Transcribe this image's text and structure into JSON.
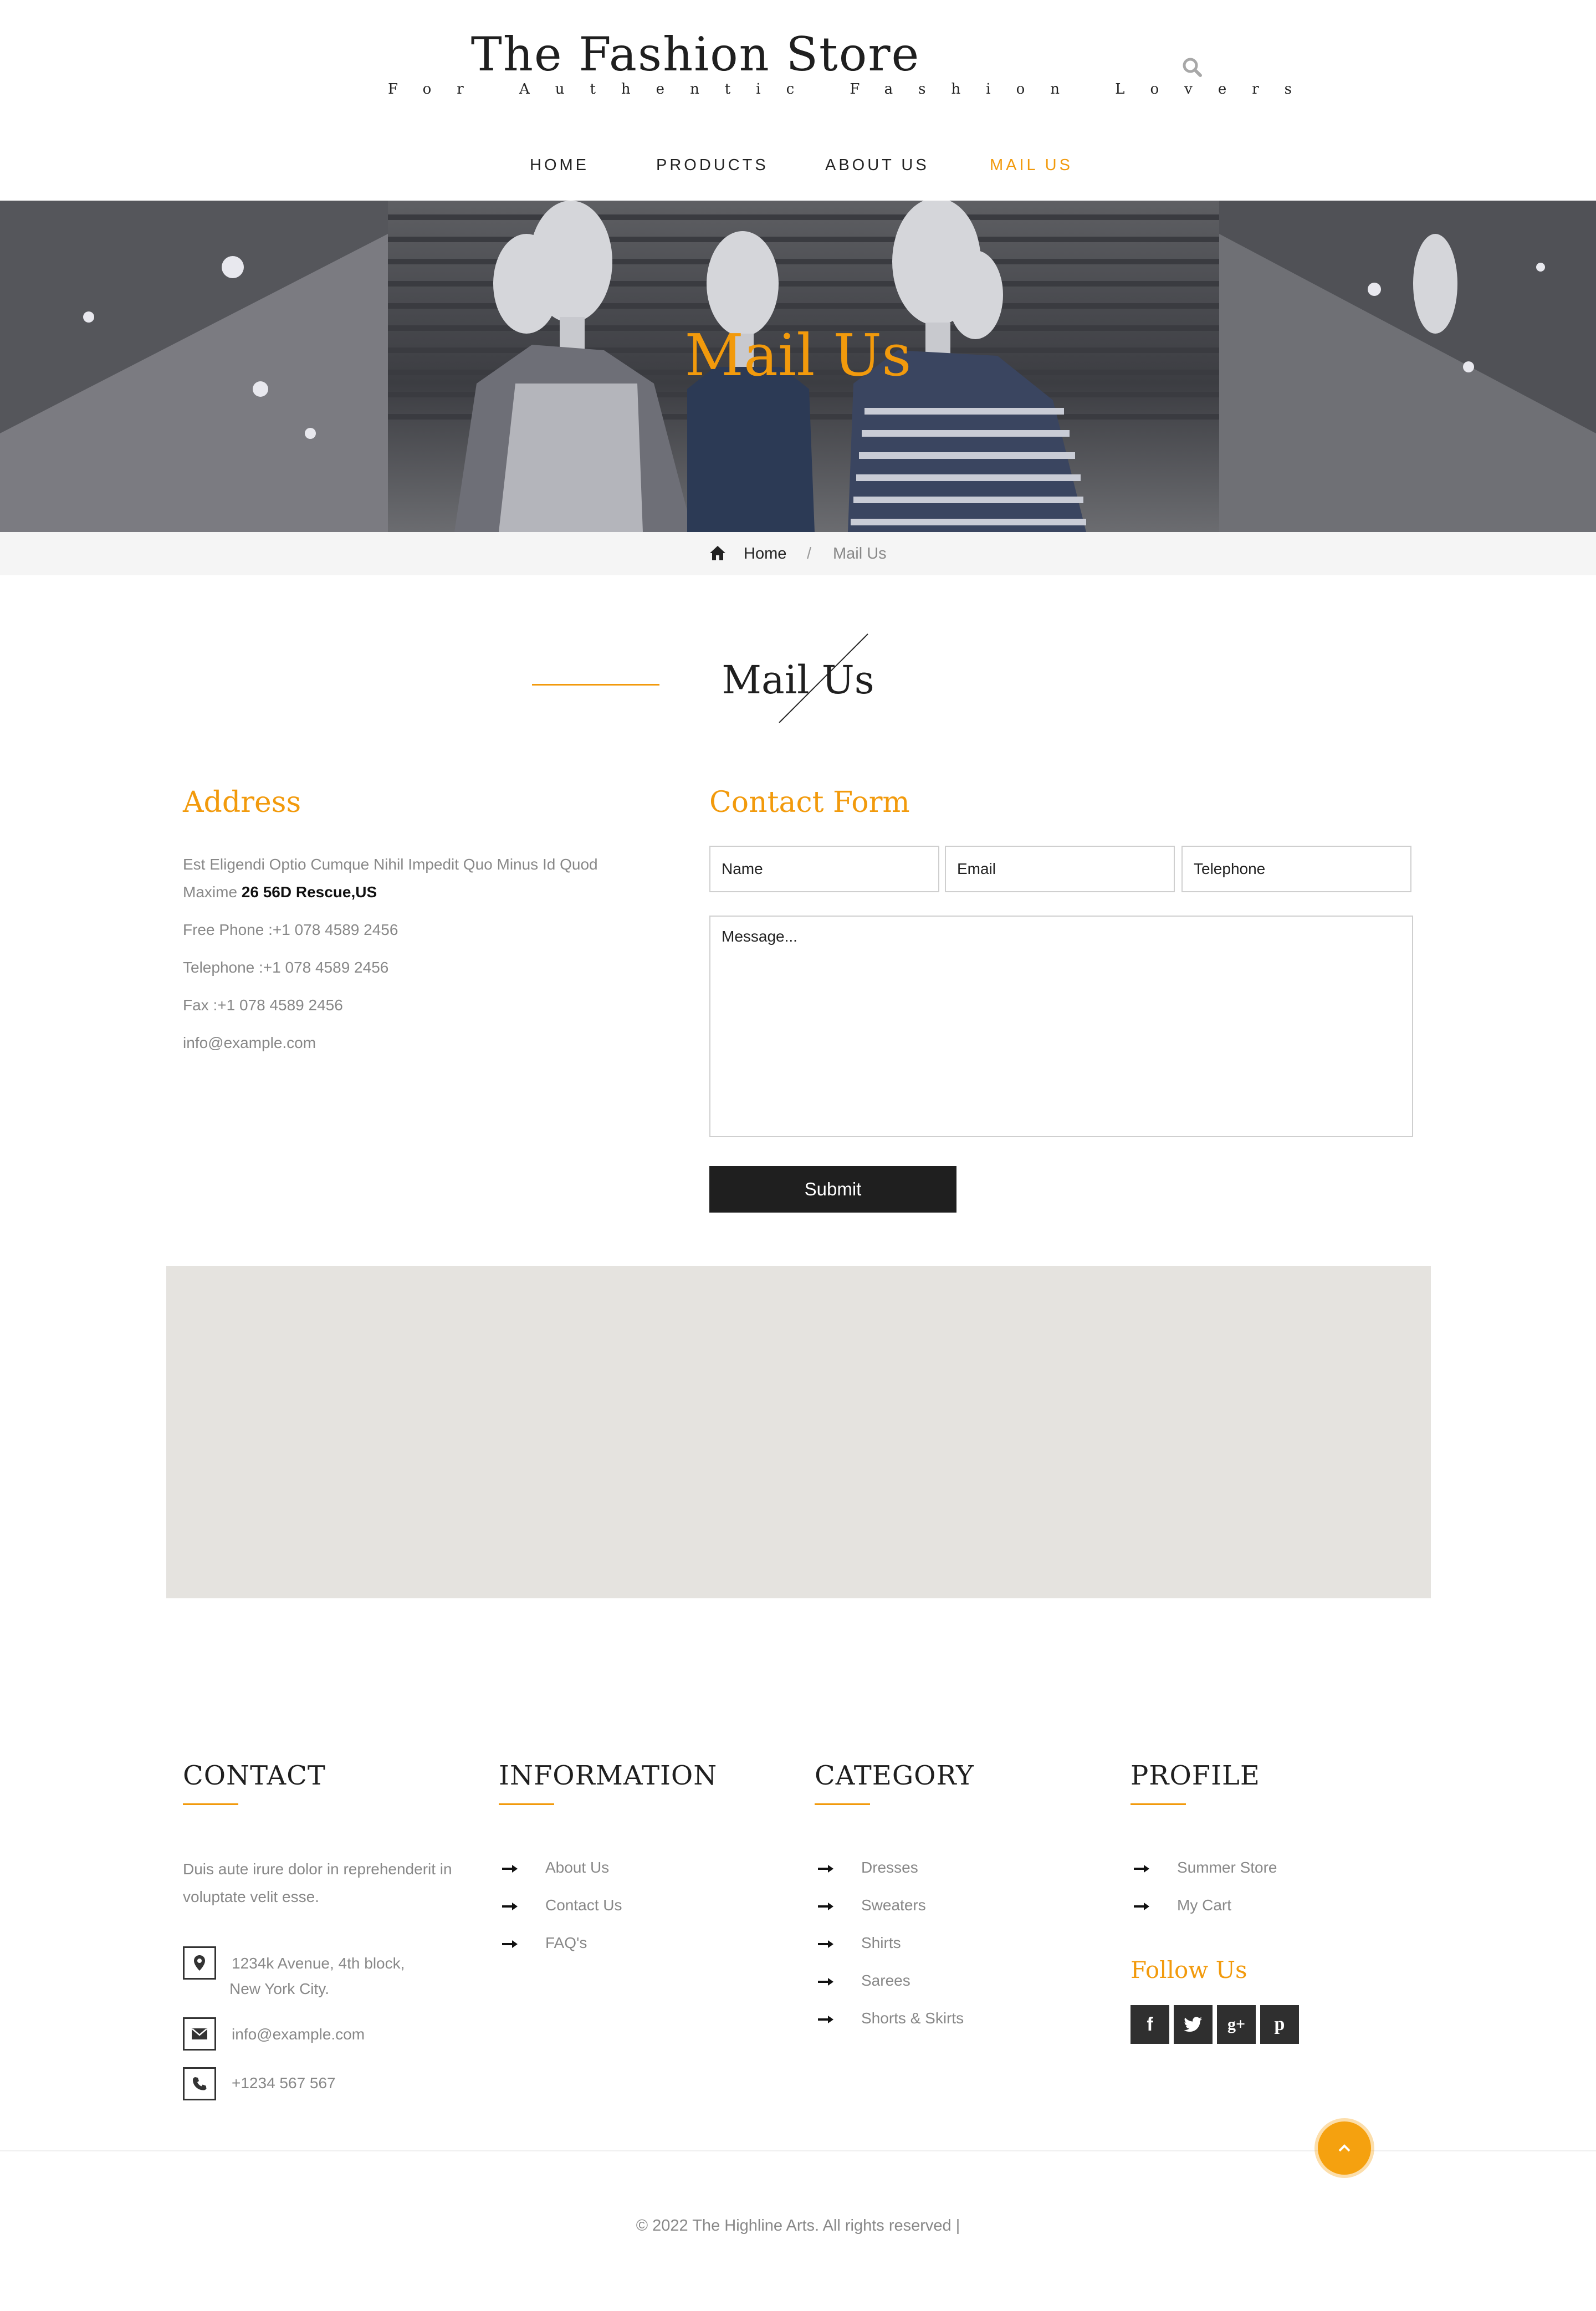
{
  "brand": {
    "title": "The Fashion Store",
    "tagline": "For Authentic Fashion Lovers"
  },
  "nav": {
    "items": [
      {
        "label": "HOME",
        "active": false
      },
      {
        "label": "PRODUCTS",
        "active": false
      },
      {
        "label": "ABOUT US",
        "active": false
      },
      {
        "label": "MAIL US",
        "active": true
      }
    ]
  },
  "banner": {
    "title": "Mail Us"
  },
  "breadcrumb": {
    "home": "Home",
    "separator": "/",
    "current": "Mail Us"
  },
  "section": {
    "title": "Mail Us"
  },
  "address": {
    "heading": "Address",
    "line": "Est Eligendi Optio Cumque Nihil Impedit Quo Minus Id Quod Maxime",
    "line_bold": "26 56D Rescue,US",
    "free_phone": "Free Phone :+1 078 4589 2456",
    "telephone": "Telephone :+1 078 4589 2456",
    "fax": "Fax :+1 078 4589 2456",
    "email": "info@example.com"
  },
  "contact_form": {
    "heading": "Contact Form",
    "name_placeholder": "Name",
    "email_placeholder": "Email",
    "telephone_placeholder": "Telephone",
    "message_placeholder": "Message...",
    "submit_label": "Submit"
  },
  "footer": {
    "contact": {
      "heading": "CONTACT",
      "text": "Duis aute irure dolor in reprehenderit in voluptate velit esse.",
      "address_line1": "1234k Avenue, 4th block,",
      "address_line2": "New York City.",
      "email": "info@example.com",
      "phone": "+1234 567 567"
    },
    "information": {
      "heading": "INFORMATION",
      "links": [
        "About Us",
        "Contact Us",
        "FAQ's"
      ]
    },
    "category": {
      "heading": "CATEGORY",
      "links": [
        "Dresses",
        "Sweaters",
        "Shirts",
        "Sarees",
        "Shorts & Skirts"
      ]
    },
    "profile": {
      "heading": "PROFILE",
      "links": [
        "Summer Store",
        "My Cart"
      ],
      "follow_heading": "Follow Us",
      "social": [
        {
          "icon": "facebook-icon",
          "glyph": "f"
        },
        {
          "icon": "twitter-icon",
          "glyph": "t"
        },
        {
          "icon": "google-plus-icon",
          "glyph": "g+"
        },
        {
          "icon": "pinterest-icon",
          "glyph": "p"
        }
      ]
    },
    "copyright": "© 2022 The Highline Arts. All rights reserved |"
  },
  "colors": {
    "accent": "#f29a0c",
    "dark": "#1f1f1f",
    "muted": "#888888",
    "map": "#e5e3df"
  }
}
